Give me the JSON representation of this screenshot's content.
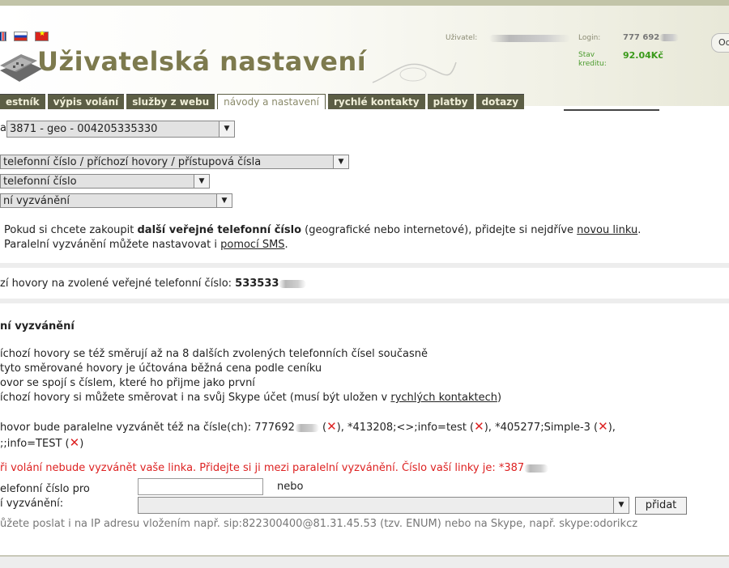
{
  "header": {
    "title": "Uživatelská nastavení",
    "user_label": "Uživatel:",
    "login_label": "Login:",
    "login_value": "777 692",
    "credit_label_1": "Stav",
    "credit_label_2": "kreditu:",
    "credit_value": "92.04Kč",
    "logout_label": "Od"
  },
  "tabs": [
    {
      "label": "estník"
    },
    {
      "label": "výpis volání"
    },
    {
      "label": "služby z webu"
    },
    {
      "label": "návody a nastavení"
    },
    {
      "label": "rychlé kontakty"
    },
    {
      "label": "platby"
    },
    {
      "label": "dotazy"
    }
  ],
  "line_select": {
    "prefix": "a",
    "value": "3871   - geo - 004205335330"
  },
  "selects": {
    "category": "telefonní číslo / příchozí hovory / přístupová čísla",
    "subcategory": "telefonní číslo",
    "feature": "ní vyzvánění"
  },
  "info": {
    "line1_pre": "Pokud si chcete zakoupit ",
    "line1_bold": "další veřejné telefonní číslo",
    "line1_mid": " (geografické nebo internetové), přidejte si nejdříve ",
    "line1_link": "novou linku",
    "line1_end": ".",
    "line2_pre": "Paralelní vyzvánění můžete nastavovat i ",
    "line2_link": "pomocí SMS",
    "line2_end": "."
  },
  "incoming": {
    "label": "zí hovory na zvolené veřejné telefonní číslo: ",
    "number": "533533"
  },
  "section": {
    "heading": "ní vyzvánění",
    "bullet1": "íchozí hovory se též směrují až na 8 dalších zvolených telefonních čísel současně",
    "bullet2": "tyto směrované hovory je účtována běžná cena podle ceníku",
    "bullet3": "ovor se spojí s číslem, které ho přijme jako první",
    "bullet4_pre": "íchozí hovory si můžete směrovat i na svůj Skype účet (musí být uložen v ",
    "bullet4_link": "rychlých kontaktech",
    "bullet4_end": ")"
  },
  "parallel": {
    "line1_pre": "hovor bude paralelne vyzvánět též na čísle(ch): 777692",
    "item2": "*413208;<>;info=test",
    "item3": "*405277;Simple-3",
    "line2_pre": ";;info=TEST",
    "remove_glyph": "✕"
  },
  "warning": "ři volání nebude vyzvánět vaše linka. Přidejte si ji mezi paralelní vyzvánění. Číslo vaší linky je: *387",
  "form": {
    "label1": "elefonní číslo pro",
    "label2": "í vyzvánění:",
    "or_label": "nebo",
    "add_button": "přidat",
    "number_value": "",
    "contact_value": ""
  },
  "hint": "ůžete poslat i na IP adresu vložením např. sip:822300400@81.31.45.53 (tzv. ENUM) nebo na Skype, např. skype:odorikcz",
  "icons": {
    "dropdown": "▼"
  },
  "colors": {
    "tab_bg": "#5c5e45",
    "title": "#7d7a4e",
    "warning": "#dd2222",
    "credit": "#3a9a1a"
  }
}
